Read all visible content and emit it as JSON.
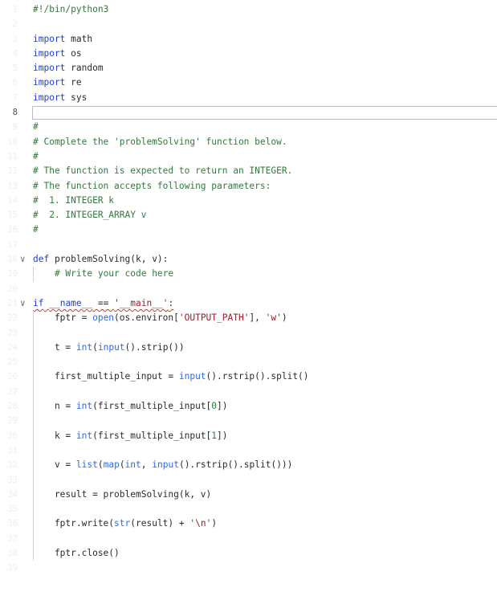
{
  "editor": {
    "language": "python",
    "active_line": 8,
    "lines": [
      {
        "n": "1",
        "tokens": [
          {
            "t": "#!/bin/python3",
            "c": "shebang"
          }
        ]
      },
      {
        "n": "2",
        "tokens": []
      },
      {
        "n": "3",
        "tokens": [
          {
            "t": "import",
            "c": "kw"
          },
          {
            "t": " math",
            "c": ""
          }
        ]
      },
      {
        "n": "4",
        "tokens": [
          {
            "t": "import",
            "c": "kw"
          },
          {
            "t": " os",
            "c": ""
          }
        ]
      },
      {
        "n": "5",
        "tokens": [
          {
            "t": "import",
            "c": "kw"
          },
          {
            "t": " random",
            "c": ""
          }
        ]
      },
      {
        "n": "6",
        "tokens": [
          {
            "t": "import",
            "c": "kw"
          },
          {
            "t": " re",
            "c": ""
          }
        ]
      },
      {
        "n": "7",
        "tokens": [
          {
            "t": "import",
            "c": "kw"
          },
          {
            "t": " sys",
            "c": ""
          }
        ]
      },
      {
        "n": "8",
        "tokens": [],
        "active": true
      },
      {
        "n": "9",
        "tokens": [
          {
            "t": "#",
            "c": "cm"
          }
        ]
      },
      {
        "n": "10",
        "tokens": [
          {
            "t": "# Complete the 'problemSolving' function below.",
            "c": "cm"
          }
        ]
      },
      {
        "n": "11",
        "tokens": [
          {
            "t": "#",
            "c": "cm"
          }
        ]
      },
      {
        "n": "12",
        "tokens": [
          {
            "t": "# The function is expected to return an INTEGER.",
            "c": "cm"
          }
        ]
      },
      {
        "n": "13",
        "tokens": [
          {
            "t": "# The function accepts following parameters:",
            "c": "cm"
          }
        ]
      },
      {
        "n": "14",
        "tokens": [
          {
            "t": "#  1. INTEGER k",
            "c": "cm"
          }
        ]
      },
      {
        "n": "15",
        "tokens": [
          {
            "t": "#  2. INTEGER_ARRAY v",
            "c": "cm"
          }
        ]
      },
      {
        "n": "16",
        "tokens": [
          {
            "t": "#",
            "c": "cm"
          }
        ]
      },
      {
        "n": "17",
        "tokens": []
      },
      {
        "n": "18",
        "fold": true,
        "tokens": [
          {
            "t": "def",
            "c": "kw"
          },
          {
            "t": " problemSolving(k, v):",
            "c": ""
          }
        ]
      },
      {
        "n": "19",
        "tokens": [
          {
            "t": "    ",
            "c": ""
          },
          {
            "t": "# Write your code here",
            "c": "cm"
          }
        ]
      },
      {
        "n": "20",
        "tokens": []
      },
      {
        "n": "21",
        "fold": true,
        "squiggle": true,
        "tokens": [
          {
            "t": "if",
            "c": "kw"
          },
          {
            "t": " ",
            "c": ""
          },
          {
            "t": "__name__",
            "c": "kw"
          },
          {
            "t": " == ",
            "c": ""
          },
          {
            "t": "'__main__'",
            "c": "st"
          },
          {
            "t": ":",
            "c": ""
          }
        ]
      },
      {
        "n": "22",
        "tokens": [
          {
            "t": "    fptr = ",
            "c": ""
          },
          {
            "t": "open",
            "c": "bi"
          },
          {
            "t": "(os.environ[",
            "c": ""
          },
          {
            "t": "'OUTPUT_PATH'",
            "c": "st"
          },
          {
            "t": "], ",
            "c": ""
          },
          {
            "t": "'w'",
            "c": "st"
          },
          {
            "t": ")",
            "c": ""
          }
        ]
      },
      {
        "n": "23",
        "tokens": []
      },
      {
        "n": "24",
        "tokens": [
          {
            "t": "    t = ",
            "c": ""
          },
          {
            "t": "int",
            "c": "bi"
          },
          {
            "t": "(",
            "c": ""
          },
          {
            "t": "input",
            "c": "bi"
          },
          {
            "t": "().strip())",
            "c": ""
          }
        ]
      },
      {
        "n": "25",
        "tokens": []
      },
      {
        "n": "26",
        "tokens": [
          {
            "t": "    first_multiple_input = ",
            "c": ""
          },
          {
            "t": "input",
            "c": "bi"
          },
          {
            "t": "().rstrip().split()",
            "c": ""
          }
        ]
      },
      {
        "n": "27",
        "tokens": []
      },
      {
        "n": "28",
        "tokens": [
          {
            "t": "    n = ",
            "c": ""
          },
          {
            "t": "int",
            "c": "bi"
          },
          {
            "t": "(first_multiple_input[",
            "c": ""
          },
          {
            "t": "0",
            "c": "num"
          },
          {
            "t": "])",
            "c": ""
          }
        ]
      },
      {
        "n": "29",
        "tokens": []
      },
      {
        "n": "30",
        "tokens": [
          {
            "t": "    k = ",
            "c": ""
          },
          {
            "t": "int",
            "c": "bi"
          },
          {
            "t": "(first_multiple_input[",
            "c": ""
          },
          {
            "t": "1",
            "c": "num"
          },
          {
            "t": "])",
            "c": ""
          }
        ]
      },
      {
        "n": "31",
        "tokens": []
      },
      {
        "n": "32",
        "tokens": [
          {
            "t": "    v = ",
            "c": ""
          },
          {
            "t": "list",
            "c": "bi"
          },
          {
            "t": "(",
            "c": ""
          },
          {
            "t": "map",
            "c": "bi"
          },
          {
            "t": "(",
            "c": ""
          },
          {
            "t": "int",
            "c": "bi"
          },
          {
            "t": ", ",
            "c": ""
          },
          {
            "t": "input",
            "c": "bi"
          },
          {
            "t": "().rstrip().split()))",
            "c": ""
          }
        ]
      },
      {
        "n": "33",
        "tokens": []
      },
      {
        "n": "34",
        "tokens": [
          {
            "t": "    result = problemSolving(k, v)",
            "c": ""
          }
        ]
      },
      {
        "n": "35",
        "tokens": []
      },
      {
        "n": "36",
        "tokens": [
          {
            "t": "    fptr.write(",
            "c": ""
          },
          {
            "t": "str",
            "c": "bi"
          },
          {
            "t": "(result) + ",
            "c": ""
          },
          {
            "t": "'\\n'",
            "c": "st"
          },
          {
            "t": ")",
            "c": ""
          }
        ]
      },
      {
        "n": "37",
        "tokens": []
      },
      {
        "n": "38",
        "tokens": [
          {
            "t": "    fptr.close()",
            "c": ""
          }
        ]
      },
      {
        "n": "39",
        "tokens": []
      }
    ]
  }
}
